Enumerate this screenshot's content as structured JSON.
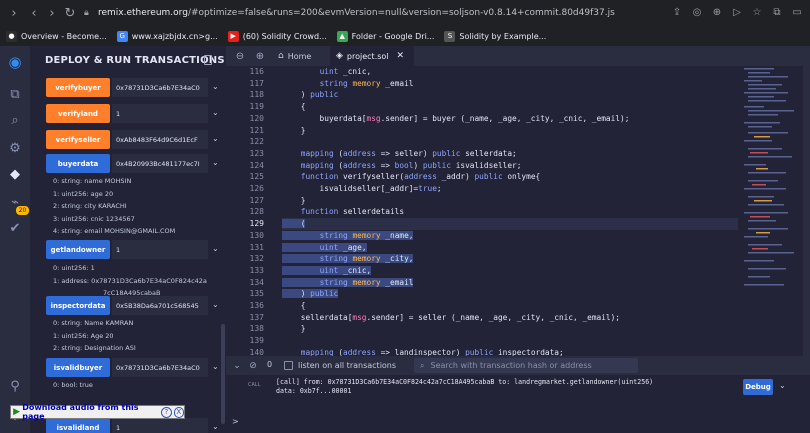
{
  "browser": {
    "url_host": "remix.ethereum.org",
    "url_rest": "/#optimize=false&runs=200&evmVersion=null&version=soljson-v0.8.14+commit.80d49f37.js",
    "bookmarks": [
      {
        "label": "Overview - Become...",
        "color": "#2d2d2d",
        "glyph": "●"
      },
      {
        "label": "www.xajzbjdx.cn>g...",
        "color": "#4285f4",
        "glyph": "G"
      },
      {
        "label": "(60) Solidity Crowd...",
        "color": "#e62117",
        "glyph": "▶"
      },
      {
        "label": "Folder - Google Dri...",
        "color": "#34a853",
        "glyph": "▲"
      },
      {
        "label": "Solidity by Example...",
        "color": "#555555",
        "glyph": "S"
      }
    ]
  },
  "panel": {
    "title": "DEPLOY & RUN TRANSACTIONS",
    "functions": [
      {
        "label": "verifybuyer",
        "kind": "orange",
        "value": "0x78731D3Ca6b7E34aC0"
      },
      {
        "label": "verifyland",
        "kind": "orange",
        "value": "1"
      },
      {
        "label": "verifyseller",
        "kind": "orange",
        "value": "0xAb8483F64d9C6d1EcF"
      },
      {
        "label": "buyerdata",
        "kind": "blue",
        "value": "0x4B20993Bc481177ec7I"
      },
      {
        "label": "getlandowner",
        "kind": "blue",
        "value": "1"
      },
      {
        "label": "inspectordata",
        "kind": "blue",
        "value": "0x5B38Da6a701c568545"
      },
      {
        "label": "isvalidbuyer",
        "kind": "blue",
        "value": "0x78731D3Ca6b7E34aC0"
      },
      {
        "label": "isvalidland",
        "kind": "blue",
        "value": "1"
      }
    ],
    "outputs": {
      "buyerdata": [
        "0: string: name MOHSIN",
        "1: uint256: age 20",
        "2: string: city KARACHI",
        "3: uint256: cnic 1234567",
        "4: string: email MOHSIN@GMAIL.COM"
      ],
      "getlandowner": [
        "0: uint256: 1",
        "1: address: 0x78731D3Ca6b7E34aC0F824c42a",
        "7cC18A495cabaB"
      ],
      "inspectordata": [
        "0: string: Name KAMRAN",
        "1: uint256: Age 20",
        "2: string: Designation ASI"
      ],
      "isvalidbuyer": [
        "0: bool: true"
      ],
      "isvalidland": [
        "0: bool: true"
      ]
    }
  },
  "download_bar": {
    "label": "Download audio from this page",
    "help": "?",
    "close": "X"
  },
  "editor": {
    "tabs": {
      "home": "Home",
      "project": "project.sol"
    },
    "line_numbers": [
      "116",
      "117",
      "118",
      "119",
      "120",
      "121",
      "122",
      "123",
      "124",
      "125",
      "126",
      "127",
      "128",
      "129",
      "130",
      "131",
      "132",
      "133",
      "134",
      "135",
      "136",
      "137",
      "138",
      "139",
      "140"
    ],
    "current_line": "129",
    "code": [
      "        uint _cnic,",
      "        string memory _email",
      "    ) public",
      "    {",
      "        buyerdata[msg.sender] = buyer (_name, _age, _city, _cnic, _email);",
      "    }",
      "",
      "    mapping (address => seller) public sellerdata;",
      "    mapping (address => bool) public isvalidseller;",
      "    function verifyseller(address _addr) public onlyme{",
      "        isvalidseller[_addr]=true;",
      "    }",
      "    function sellerdetails",
      "    (",
      "        string memory _name,",
      "        uint _age,",
      "        string memory _city,",
      "        uint _cnic,",
      "        string memory _email",
      "    ) public",
      "    {",
      "    sellerdata[msg.sender] = seller (_name, _age, _city, _cnic, _email);",
      "    }",
      "",
      "    mapping (address => landinspector) public inspectordata;"
    ]
  },
  "terminal": {
    "badge": "0",
    "listen_label": "listen on all transactions",
    "search_placeholder": "Search with transaction hash or address",
    "call_tag": "CALL",
    "log_line1": "[call] from: 0x78731D3Ca6b7E34aC0F824c42a7cC18A495cabaB to: landregmarket.getlandowner(uint256)",
    "log_line2": "data: 0xb7f...00001",
    "debug_label": "Debug",
    "prompt": ">"
  },
  "colors": {
    "accent": "#2f6cd8",
    "orange": "#ff7f2a",
    "bg": "#222336"
  }
}
